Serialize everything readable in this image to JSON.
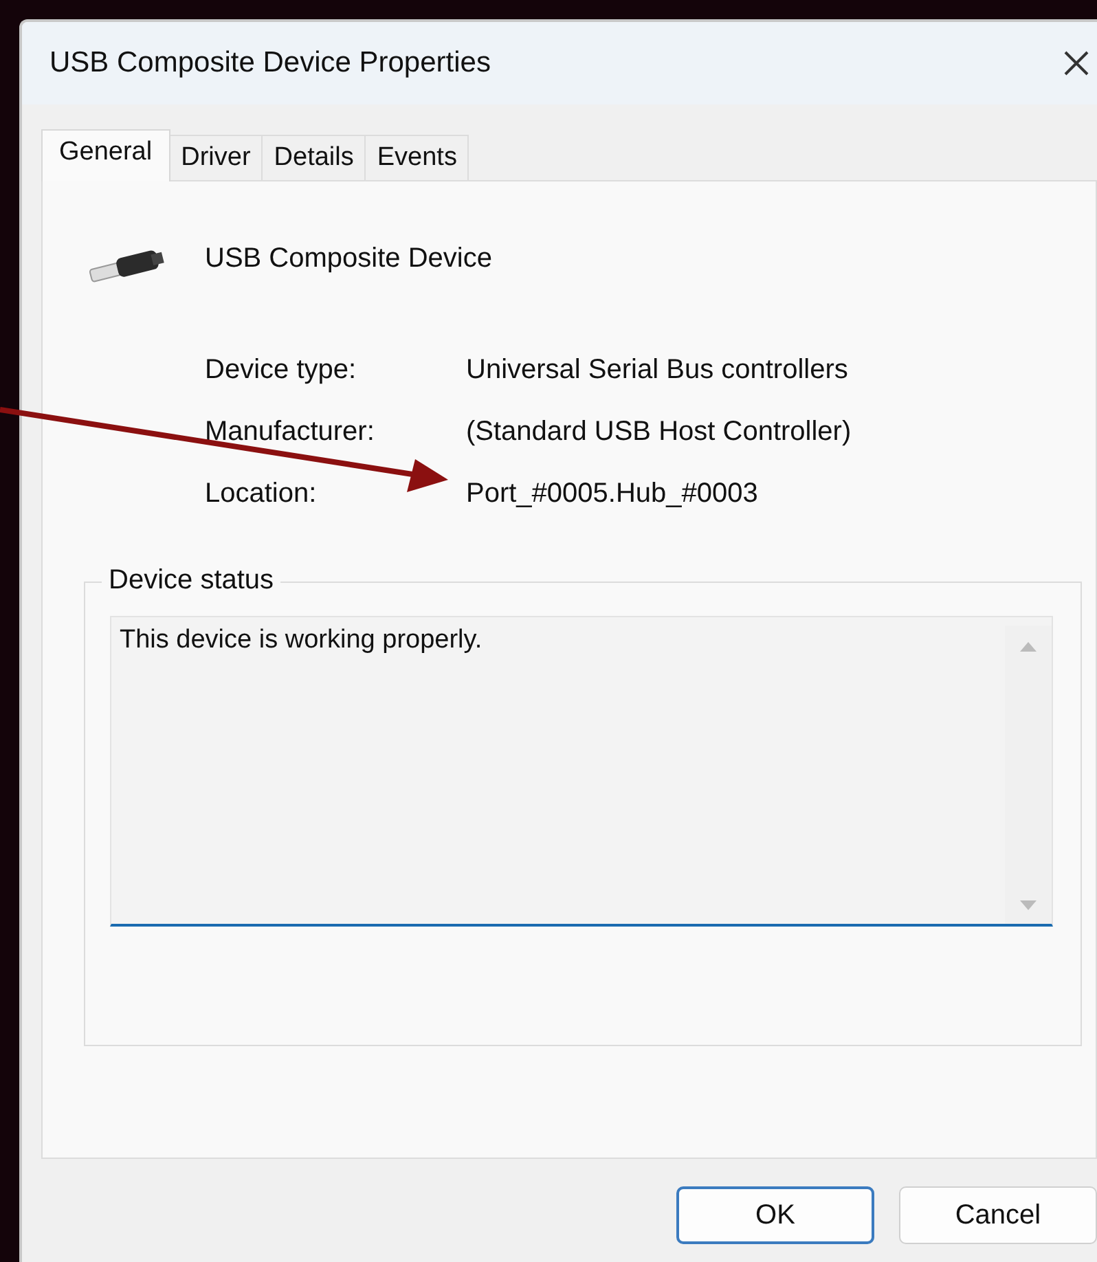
{
  "window": {
    "title": "USB Composite Device Properties"
  },
  "tabs": [
    {
      "label": "General",
      "selected": true
    },
    {
      "label": "Driver",
      "selected": false
    },
    {
      "label": "Details",
      "selected": false
    },
    {
      "label": "Events",
      "selected": false
    }
  ],
  "device": {
    "name": "USB Composite Device"
  },
  "properties": [
    {
      "label": "Device type:",
      "value": "Universal Serial Bus controllers"
    },
    {
      "label": "Manufacturer:",
      "value": "(Standard USB Host Controller)"
    },
    {
      "label": "Location:",
      "value": "Port_#0005.Hub_#0003"
    }
  ],
  "device_status": {
    "title": "Device status",
    "text": "This device is working properly."
  },
  "buttons": [
    {
      "label": "OK",
      "default": true
    },
    {
      "label": "Cancel",
      "default": false
    }
  ]
}
